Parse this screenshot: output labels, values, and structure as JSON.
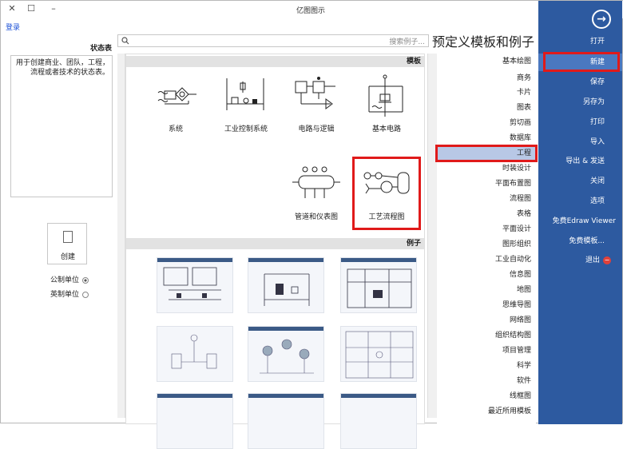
{
  "window": {
    "title": "亿图图示",
    "login": "登录"
  },
  "nav": {
    "items": [
      {
        "label": "打开",
        "active": false
      },
      {
        "label": "新建",
        "active": true
      },
      {
        "label": "保存",
        "active": false
      },
      {
        "label": "另存为",
        "active": false
      },
      {
        "label": "打印",
        "active": false
      },
      {
        "label": "导入",
        "active": false
      },
      {
        "label": "导出 & 发送",
        "active": false
      },
      {
        "label": "关闭",
        "active": false
      },
      {
        "label": "选项",
        "active": false
      },
      {
        "label": "免费Edraw Viewer",
        "active": false
      },
      {
        "label": "免费模板...",
        "active": false
      },
      {
        "label": "退出",
        "active": false
      }
    ],
    "accent": "#2d5aa0",
    "highlight": "#e01a1a"
  },
  "main": {
    "heading": "预定义模板和例子",
    "search_placeholder": "搜索例子...",
    "templates_title": "模板",
    "examples_title": "例子",
    "templates": [
      {
        "label": "基本电路",
        "icon": "basic-circuit-icon"
      },
      {
        "label": "电路与逻辑",
        "icon": "circuit-logic-icon"
      },
      {
        "label": "工业控制系统",
        "icon": "industrial-control-icon"
      },
      {
        "label": "系统",
        "icon": "system-icon"
      },
      {
        "label": "工艺流程图",
        "icon": "process-flow-icon"
      },
      {
        "label": "管道和仪表图",
        "icon": "pipe-instrument-icon"
      }
    ]
  },
  "categories": [
    "基本绘图",
    "商务",
    "卡片",
    "图表",
    "剪切画",
    "数据库",
    "工程",
    "时装设计",
    "平面布置图",
    "流程图",
    "表格",
    "平面设计",
    "图形组织",
    "工业自动化",
    "信息图",
    "地图",
    "思维导图",
    "网络图",
    "组织结构图",
    "项目管理",
    "科学",
    "软件",
    "线框图",
    "最近所用模板"
  ],
  "active_category": "工程",
  "left": {
    "heading": "状态表",
    "description": "用于创建商业、团队，工程，流程或者技术的状态表。",
    "create_label": "创建",
    "units": [
      {
        "label": "公制单位",
        "selected": true
      },
      {
        "label": "英制单位",
        "selected": false
      }
    ]
  }
}
